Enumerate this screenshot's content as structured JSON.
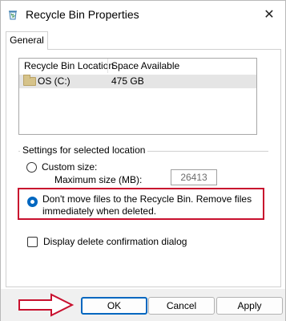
{
  "window": {
    "title": "Recycle Bin Properties",
    "close_glyph": "✕"
  },
  "tabs": [
    {
      "label": "General",
      "selected": true
    }
  ],
  "listview": {
    "columns": [
      "Recycle Bin Location",
      "Space Available"
    ],
    "rows": [
      {
        "location": "OS (C:)",
        "space": "475 GB",
        "icon": "folder-icon",
        "selected": true
      }
    ]
  },
  "settings": {
    "group_label": "Settings for selected location",
    "custom_size_label": "Custom size:",
    "max_size_label": "Maximum size (MB):",
    "max_size_value": "26413",
    "dont_move_line1": "Don't move files to the Recycle Bin. Remove files",
    "dont_move_line2": "immediately when deleted.",
    "selected_option": "dont_move",
    "confirm_label": "Display delete confirmation dialog",
    "confirm_checked": false
  },
  "buttons": {
    "ok": "OK",
    "cancel": "Cancel",
    "apply": "Apply"
  },
  "colors": {
    "accent": "#0067c0",
    "annotation": "#c8102e"
  }
}
